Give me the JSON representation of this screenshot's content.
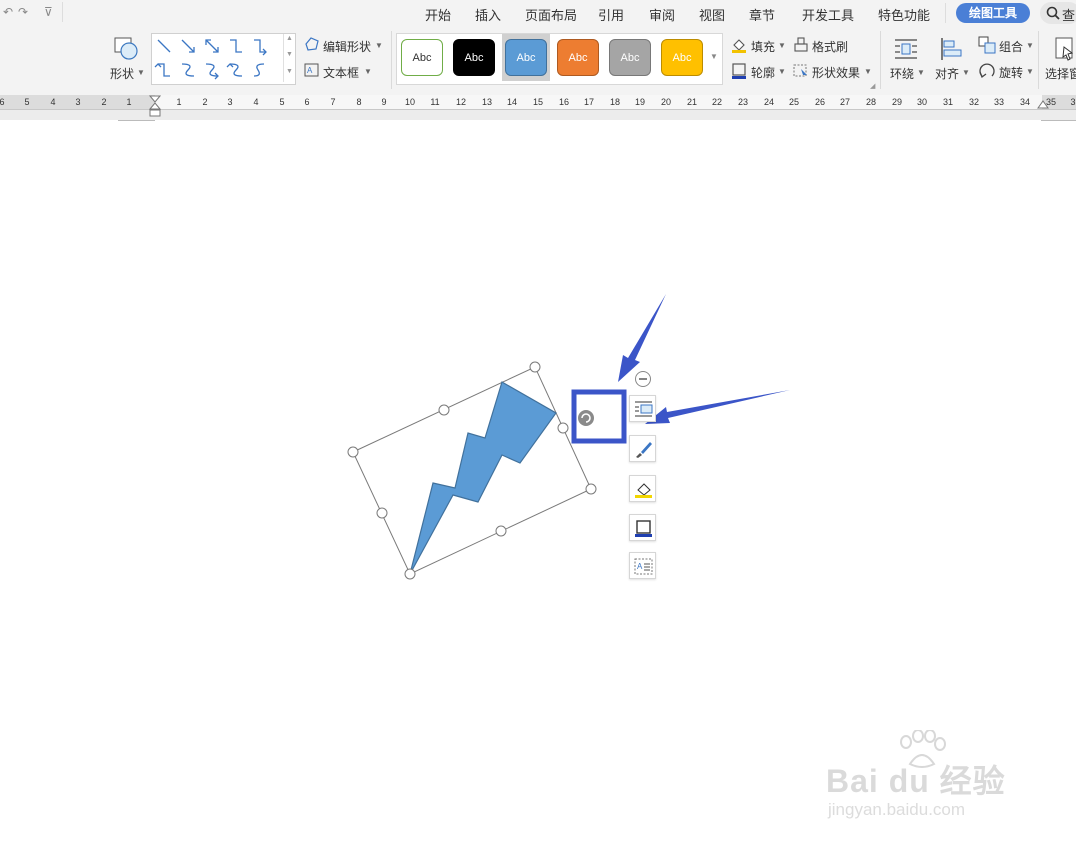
{
  "menu": {
    "quick_access": [
      "↶",
      "↷",
      "⊽"
    ],
    "tabs": [
      "开始",
      "插入",
      "页面布局",
      "引用",
      "审阅",
      "视图",
      "章节",
      "开发工具",
      "特色功能"
    ],
    "active_tab": "绘图工具",
    "search_label": "查"
  },
  "ribbon": {
    "shapes_label": "形状",
    "edit_shape_label": "编辑形状",
    "textbox_label": "文本框",
    "style_presets": [
      {
        "text": "Abc",
        "bg": "#ffffff",
        "fg": "#333333",
        "border": "#70ad47"
      },
      {
        "text": "Abc",
        "bg": "#000000",
        "fg": "#ffffff",
        "border": "#000000"
      },
      {
        "text": "Abc",
        "bg": "#5b9bd5",
        "fg": "#ffffff",
        "border": "#41719c"
      },
      {
        "text": "Abc",
        "bg": "#ed7d31",
        "fg": "#ffffff",
        "border": "#ae5a21"
      },
      {
        "text": "Abc",
        "bg": "#a5a5a5",
        "fg": "#ffffff",
        "border": "#787878"
      },
      {
        "text": "Abc",
        "bg": "#ffc000",
        "fg": "#ffffff",
        "border": "#bc8c00"
      }
    ],
    "fill_label": "填充",
    "format_painter_label": "格式刷",
    "outline_label": "轮廓",
    "shape_effects_label": "形状效果",
    "wrap_label": "环绕",
    "align_label": "对齐",
    "group_label": "组合",
    "rotate_label": "旋转",
    "select_pane_label": "选择窗"
  },
  "ruler": {
    "left_ticks": [
      "6",
      "5",
      "4",
      "3",
      "2",
      "1"
    ],
    "right_ticks": [
      "1",
      "2",
      "3",
      "4",
      "5",
      "6",
      "7",
      "8",
      "9",
      "10",
      "11",
      "12",
      "13",
      "14",
      "15",
      "16",
      "17",
      "18",
      "19",
      "20",
      "21",
      "22",
      "23",
      "24",
      "25",
      "26",
      "27",
      "28",
      "29",
      "30",
      "31",
      "32",
      "33",
      "34",
      "35",
      "3"
    ]
  },
  "colors": {
    "accent": "#4a7fd6",
    "shape_fill": "#5b9bd5",
    "shape_stroke": "#41719c",
    "annotation": "#3b55c8"
  },
  "icons": {
    "side_toolbar": [
      "collapse-icon",
      "layout-options-icon",
      "shape-style-brush-icon",
      "fill-color-icon",
      "outline-icon",
      "text-wrap-icon"
    ]
  },
  "watermark": {
    "brand": "Bai du 经验",
    "url": "jingyan.baidu.com"
  }
}
